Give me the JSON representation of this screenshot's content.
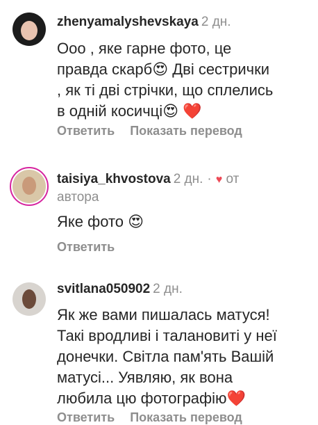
{
  "comments": [
    {
      "username": "zhenyamalyshevskaya",
      "time": "2 дн.",
      "lines": [
        "Ооо , яке гарне фото, це",
        "правда скарб😍 Дві сестрички",
        ", як ті дві стрічки, що сплелись",
        "в одній косичці😍 ❤️"
      ],
      "actions": [
        "Ответить",
        "Показать перевод"
      ]
    },
    {
      "username": "taisiya_khvostova",
      "time": "2 дн.",
      "dot": "·",
      "liked_icon": "heart-icon",
      "author_tag_1": "от",
      "author_tag_2": "автора",
      "lines": [
        "Яке фото 😍"
      ],
      "actions": [
        "Ответить"
      ]
    },
    {
      "username": "svitlana050902",
      "time": "2 дн.",
      "lines": [
        "Як же вами пишалась матуся!",
        "Такі вродливі і талановиті у неї",
        "донечки. Світла пам'ять Вашій",
        "матусі... Уявляю, як вона",
        "любила цю фотографію❤️"
      ],
      "actions": [
        "Ответить",
        "Показать перевод"
      ]
    }
  ],
  "colors": {
    "username": "#262626",
    "meta": "#8e8e8e",
    "heart": "#ed4956",
    "story_ring": "#d6249f"
  }
}
